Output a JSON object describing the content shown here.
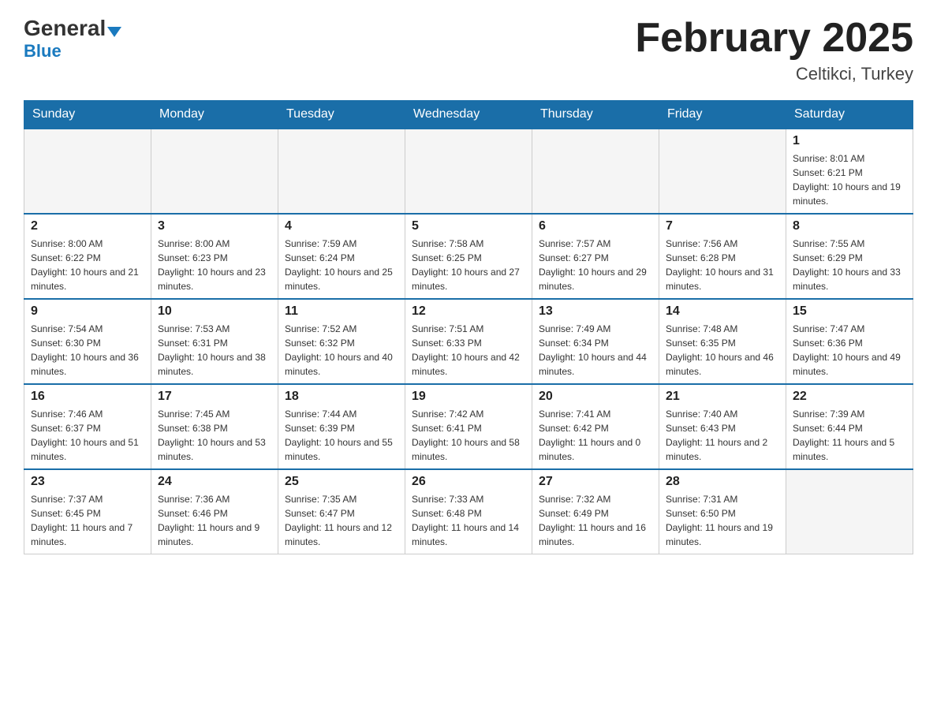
{
  "header": {
    "logo": {
      "general": "General",
      "blue": "Blue"
    },
    "title": "February 2025",
    "location": "Celtikci, Turkey"
  },
  "calendar": {
    "days_of_week": [
      "Sunday",
      "Monday",
      "Tuesday",
      "Wednesday",
      "Thursday",
      "Friday",
      "Saturday"
    ],
    "weeks": [
      [
        {
          "day": "",
          "info": ""
        },
        {
          "day": "",
          "info": ""
        },
        {
          "day": "",
          "info": ""
        },
        {
          "day": "",
          "info": ""
        },
        {
          "day": "",
          "info": ""
        },
        {
          "day": "",
          "info": ""
        },
        {
          "day": "1",
          "info": "Sunrise: 8:01 AM\nSunset: 6:21 PM\nDaylight: 10 hours and 19 minutes."
        }
      ],
      [
        {
          "day": "2",
          "info": "Sunrise: 8:00 AM\nSunset: 6:22 PM\nDaylight: 10 hours and 21 minutes."
        },
        {
          "day": "3",
          "info": "Sunrise: 8:00 AM\nSunset: 6:23 PM\nDaylight: 10 hours and 23 minutes."
        },
        {
          "day": "4",
          "info": "Sunrise: 7:59 AM\nSunset: 6:24 PM\nDaylight: 10 hours and 25 minutes."
        },
        {
          "day": "5",
          "info": "Sunrise: 7:58 AM\nSunset: 6:25 PM\nDaylight: 10 hours and 27 minutes."
        },
        {
          "day": "6",
          "info": "Sunrise: 7:57 AM\nSunset: 6:27 PM\nDaylight: 10 hours and 29 minutes."
        },
        {
          "day": "7",
          "info": "Sunrise: 7:56 AM\nSunset: 6:28 PM\nDaylight: 10 hours and 31 minutes."
        },
        {
          "day": "8",
          "info": "Sunrise: 7:55 AM\nSunset: 6:29 PM\nDaylight: 10 hours and 33 minutes."
        }
      ],
      [
        {
          "day": "9",
          "info": "Sunrise: 7:54 AM\nSunset: 6:30 PM\nDaylight: 10 hours and 36 minutes."
        },
        {
          "day": "10",
          "info": "Sunrise: 7:53 AM\nSunset: 6:31 PM\nDaylight: 10 hours and 38 minutes."
        },
        {
          "day": "11",
          "info": "Sunrise: 7:52 AM\nSunset: 6:32 PM\nDaylight: 10 hours and 40 minutes."
        },
        {
          "day": "12",
          "info": "Sunrise: 7:51 AM\nSunset: 6:33 PM\nDaylight: 10 hours and 42 minutes."
        },
        {
          "day": "13",
          "info": "Sunrise: 7:49 AM\nSunset: 6:34 PM\nDaylight: 10 hours and 44 minutes."
        },
        {
          "day": "14",
          "info": "Sunrise: 7:48 AM\nSunset: 6:35 PM\nDaylight: 10 hours and 46 minutes."
        },
        {
          "day": "15",
          "info": "Sunrise: 7:47 AM\nSunset: 6:36 PM\nDaylight: 10 hours and 49 minutes."
        }
      ],
      [
        {
          "day": "16",
          "info": "Sunrise: 7:46 AM\nSunset: 6:37 PM\nDaylight: 10 hours and 51 minutes."
        },
        {
          "day": "17",
          "info": "Sunrise: 7:45 AM\nSunset: 6:38 PM\nDaylight: 10 hours and 53 minutes."
        },
        {
          "day": "18",
          "info": "Sunrise: 7:44 AM\nSunset: 6:39 PM\nDaylight: 10 hours and 55 minutes."
        },
        {
          "day": "19",
          "info": "Sunrise: 7:42 AM\nSunset: 6:41 PM\nDaylight: 10 hours and 58 minutes."
        },
        {
          "day": "20",
          "info": "Sunrise: 7:41 AM\nSunset: 6:42 PM\nDaylight: 11 hours and 0 minutes."
        },
        {
          "day": "21",
          "info": "Sunrise: 7:40 AM\nSunset: 6:43 PM\nDaylight: 11 hours and 2 minutes."
        },
        {
          "day": "22",
          "info": "Sunrise: 7:39 AM\nSunset: 6:44 PM\nDaylight: 11 hours and 5 minutes."
        }
      ],
      [
        {
          "day": "23",
          "info": "Sunrise: 7:37 AM\nSunset: 6:45 PM\nDaylight: 11 hours and 7 minutes."
        },
        {
          "day": "24",
          "info": "Sunrise: 7:36 AM\nSunset: 6:46 PM\nDaylight: 11 hours and 9 minutes."
        },
        {
          "day": "25",
          "info": "Sunrise: 7:35 AM\nSunset: 6:47 PM\nDaylight: 11 hours and 12 minutes."
        },
        {
          "day": "26",
          "info": "Sunrise: 7:33 AM\nSunset: 6:48 PM\nDaylight: 11 hours and 14 minutes."
        },
        {
          "day": "27",
          "info": "Sunrise: 7:32 AM\nSunset: 6:49 PM\nDaylight: 11 hours and 16 minutes."
        },
        {
          "day": "28",
          "info": "Sunrise: 7:31 AM\nSunset: 6:50 PM\nDaylight: 11 hours and 19 minutes."
        },
        {
          "day": "",
          "info": ""
        }
      ]
    ]
  }
}
